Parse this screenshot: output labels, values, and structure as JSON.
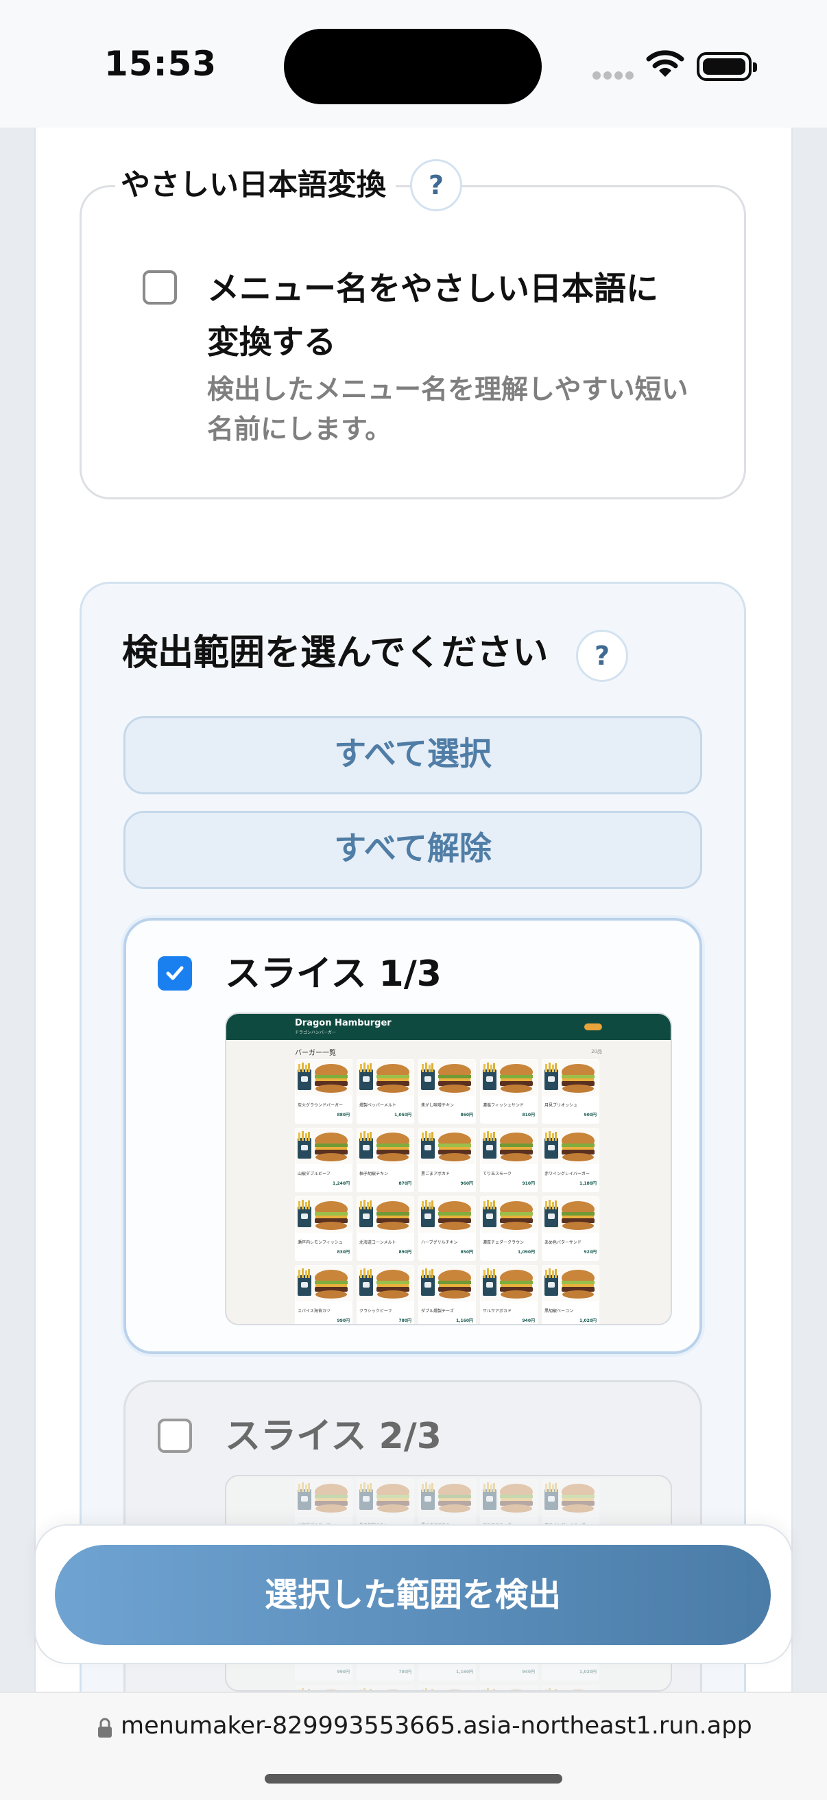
{
  "status_bar": {
    "time": "15:53"
  },
  "simple_japanese": {
    "legend": "やさしい日本語変換",
    "help": "?",
    "checkbox_label": "メニュー名をやさしい日本語に",
    "checkbox_label_cont": "変換する",
    "description": "検出したメニュー名を理解しやすい短い名前にします。",
    "checked": false
  },
  "range_select": {
    "heading": "検出範囲を選んでください",
    "help": "?",
    "select_all_label": "すべて選択",
    "deselect_all_label": "すべて解除",
    "slices": [
      {
        "title": "スライス 1/3",
        "checked": true
      },
      {
        "title": "スライス 2/3",
        "checked": false
      }
    ]
  },
  "menu_preview": {
    "restaurant": "Dragon Hamburger",
    "subtitle": "ドラゴンハンバーガー",
    "section": "バーガー一覧",
    "section_note": "20品",
    "items": [
      {
        "name": "炭火グラウンドバーガー",
        "price": "880円"
      },
      {
        "name": "燻製ペッパーメルト",
        "price": "1,050円"
      },
      {
        "name": "焦がし味噌チキン",
        "price": "860円"
      },
      {
        "name": "濃塩フィッシュサンド",
        "price": "810円"
      },
      {
        "name": "月見ブリオッシュ",
        "price": "900円"
      },
      {
        "name": "山椒ダブルビーフ",
        "price": "1,240円"
      },
      {
        "name": "柚子胡椒チキン",
        "price": "870円"
      },
      {
        "name": "黒ごまアボカド",
        "price": "960円"
      },
      {
        "name": "てり玉スモーク",
        "price": "910円"
      },
      {
        "name": "赤ワイングレイバーガー",
        "price": "1,180円"
      },
      {
        "name": "瀬戸内レモンフィッシュ",
        "price": "830円"
      },
      {
        "name": "北海道コーンメルト",
        "price": "890円"
      },
      {
        "name": "ハーブグリルチキン",
        "price": "850円"
      },
      {
        "name": "濃厚チェダークラウン",
        "price": "1,090円"
      },
      {
        "name": "あめ色バターサンド",
        "price": "920円"
      },
      {
        "name": "スパイス海苔カツ",
        "price": "990円"
      },
      {
        "name": "クラシックビーフ",
        "price": "780円"
      },
      {
        "name": "ダブル燻製チーズ",
        "price": "1,160円"
      },
      {
        "name": "サルサアボカド",
        "price": "940円"
      },
      {
        "name": "黒胡椒ベーコン",
        "price": "1,020円"
      }
    ]
  },
  "action": {
    "detect_button": "選択した範囲を検出"
  },
  "url_bar": {
    "url": "menumaker-829993553665.asia-northeast1.run.app"
  },
  "colors": {
    "accent": "#1a80f0",
    "button_start": "#6fa3d1",
    "button_end": "#4b7ca8",
    "secondary_text": "#4f7da6"
  }
}
